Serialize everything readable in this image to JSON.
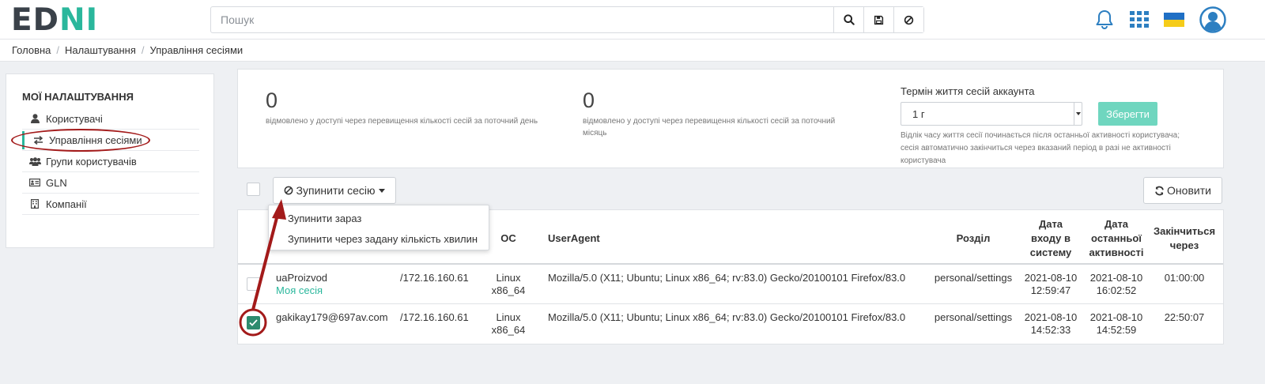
{
  "header": {
    "logo": {
      "p1": "E",
      "p2": "D",
      "p3": "N",
      "p4": "I"
    },
    "search": {
      "placeholder": "Пошук",
      "value": ""
    },
    "icons": [
      "search-icon",
      "save-icon",
      "ban-icon",
      "bell-icon",
      "apps-grid-icon",
      "ukraine-flag-icon",
      "user-avatar-icon"
    ],
    "brand_color": "#2ab79c"
  },
  "breadcrumb": [
    "Головна",
    "Налаштування",
    "Управління сесіями"
  ],
  "sidebar": {
    "title": "МОЇ НАЛАШТУВАННЯ",
    "items": [
      {
        "label": "Користувачі",
        "icon": "user-icon"
      },
      {
        "label": "Управління сесіями",
        "icon": "exchange-icon",
        "active": true
      },
      {
        "label": "Групи користувачів",
        "icon": "users-icon"
      },
      {
        "label": "GLN",
        "icon": "id-card-icon"
      },
      {
        "label": "Компанії",
        "icon": "building-icon"
      }
    ]
  },
  "stats": {
    "day": {
      "value": "0",
      "label": "відмовлено у доступі через перевищення кількості сесій за поточний день"
    },
    "month": {
      "value": "0",
      "label_line1": "відмовлено у доступі через перевищення кількості сесій за поточний",
      "label_line2": "місяць"
    },
    "lifetime": {
      "title": "Термін життя сесій аккаунта",
      "selected": "1 г",
      "save_label": "Зберегти",
      "note_line1": "Відлік часу життя сесії починається після останньої активності користувача;",
      "note_line2": "сесія автоматично закінчиться через вказаний період в разі не активності",
      "note_line3": "користувача"
    }
  },
  "toolbar": {
    "stop_label": "Зупинити сесію",
    "refresh_label": "Оновити",
    "dropdown": [
      "Зупинити зараз",
      "Зупинити через задану кількість хвилин"
    ]
  },
  "table": {
    "headers": {
      "os": "ОС",
      "useragent": "UserAgent",
      "section": "Розділ",
      "login_1": "Дата",
      "login_2": "входу в",
      "login_3": "систему",
      "last_1": "Дата",
      "last_2": "останньої",
      "last_3": "активності",
      "ends_1": "Закінчиться",
      "ends_2": "через"
    },
    "rows": [
      {
        "user": "uaProizvod",
        "badge": "Моя сесія",
        "ip": "/172.16.160.61",
        "os_1": "Linux",
        "os_2": "x86_64",
        "useragent": "Mozilla/5.0 (X11; Ubuntu; Linux x86_64; rv:83.0) Gecko/20100101 Firefox/83.0",
        "section": "personal/settings",
        "login_date": "2021-08-10",
        "login_time": "12:59:47",
        "last_date": "2021-08-10",
        "last_time": "16:02:52",
        "ends": "01:00:00",
        "checked": false
      },
      {
        "user": "gakikay179@697av.com",
        "ip": "/172.16.160.61",
        "os_1": "Linux",
        "os_2": "x86_64",
        "useragent": "Mozilla/5.0 (X11; Ubuntu; Linux x86_64; rv:83.0) Gecko/20100101 Firefox/83.0",
        "section": "personal/settings",
        "login_date": "2021-08-10",
        "login_time": "14:52:33",
        "last_date": "2021-08-10",
        "last_time": "14:52:59",
        "ends": "22:50:07",
        "checked": true
      }
    ]
  },
  "annotation_color": "#a31a1a"
}
